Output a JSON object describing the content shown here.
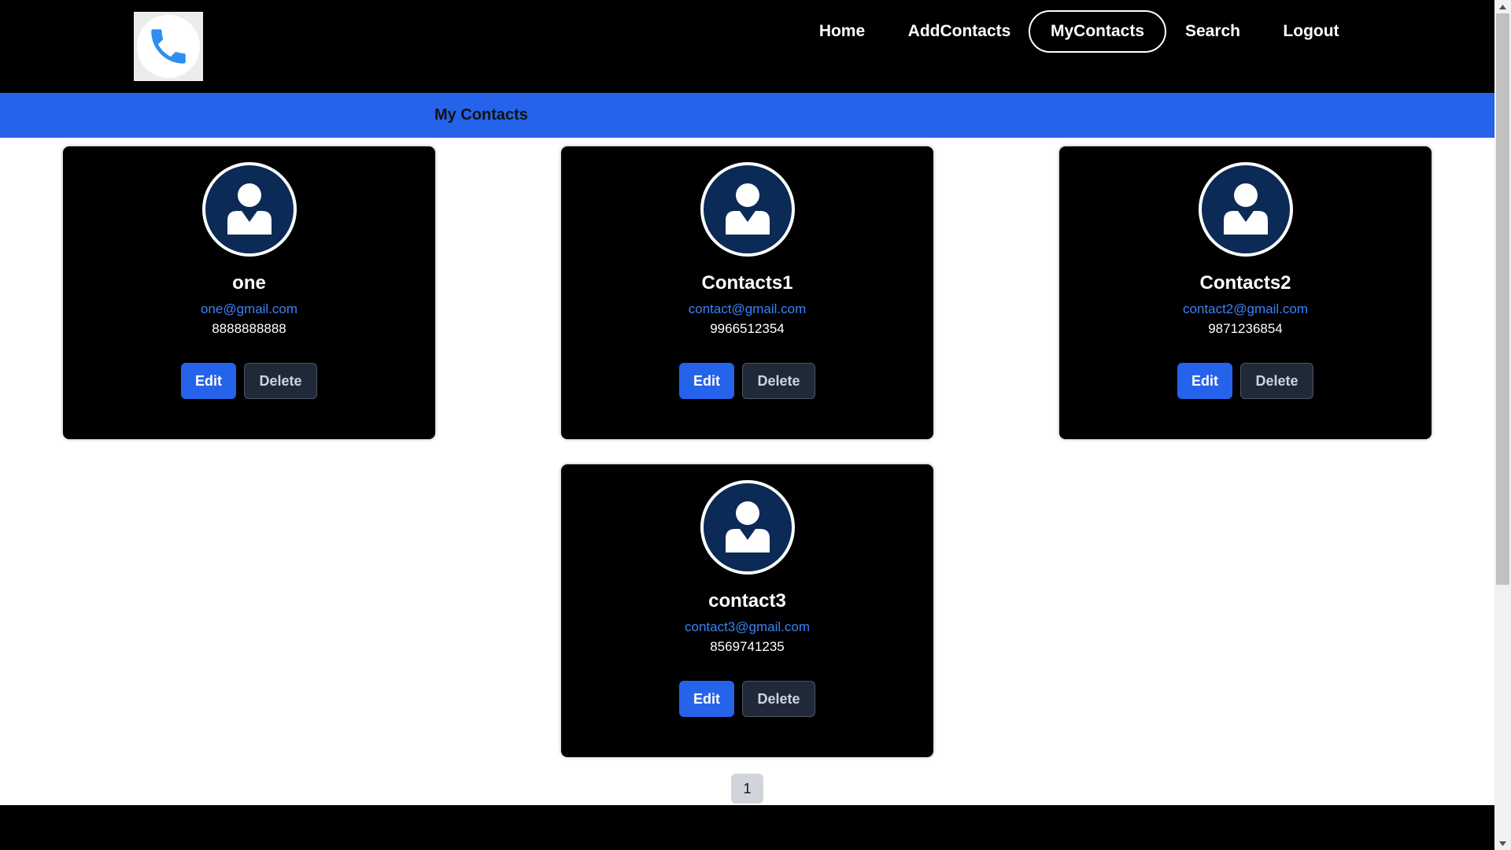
{
  "nav": {
    "logo_icon": "phone-icon",
    "links": [
      {
        "label": "Home",
        "active": false
      },
      {
        "label": "AddContacts",
        "active": false
      },
      {
        "label": "MyContacts",
        "active": true
      },
      {
        "label": "Search",
        "active": false
      },
      {
        "label": "Logout",
        "active": false
      }
    ]
  },
  "section": {
    "title": "My Contacts"
  },
  "contacts": [
    {
      "name": "one",
      "email": "one@gmail.com",
      "phone": "8888888888",
      "avatar_icon": "user-icon",
      "edit_label": "Edit",
      "delete_label": "Delete"
    },
    {
      "name": "Contacts1",
      "email": "contact@gmail.com",
      "phone": "9966512354",
      "avatar_icon": "user-icon",
      "edit_label": "Edit",
      "delete_label": "Delete"
    },
    {
      "name": "Contacts2",
      "email": "contact2@gmail.com",
      "phone": "9871236854",
      "avatar_icon": "user-icon",
      "edit_label": "Edit",
      "delete_label": "Delete"
    },
    {
      "name": "contact3",
      "email": "contact3@gmail.com",
      "phone": "8569741235",
      "avatar_icon": "user-icon",
      "edit_label": "Edit",
      "delete_label": "Delete"
    }
  ],
  "pagination": {
    "current_page": "1"
  },
  "colors": {
    "nav_bg": "#000000",
    "section_bar": "#2563eb",
    "edit_button": "#2563eb",
    "delete_button": "#1f2937",
    "email_link": "#3b82f6",
    "avatar_bg": "#0b2a55"
  }
}
